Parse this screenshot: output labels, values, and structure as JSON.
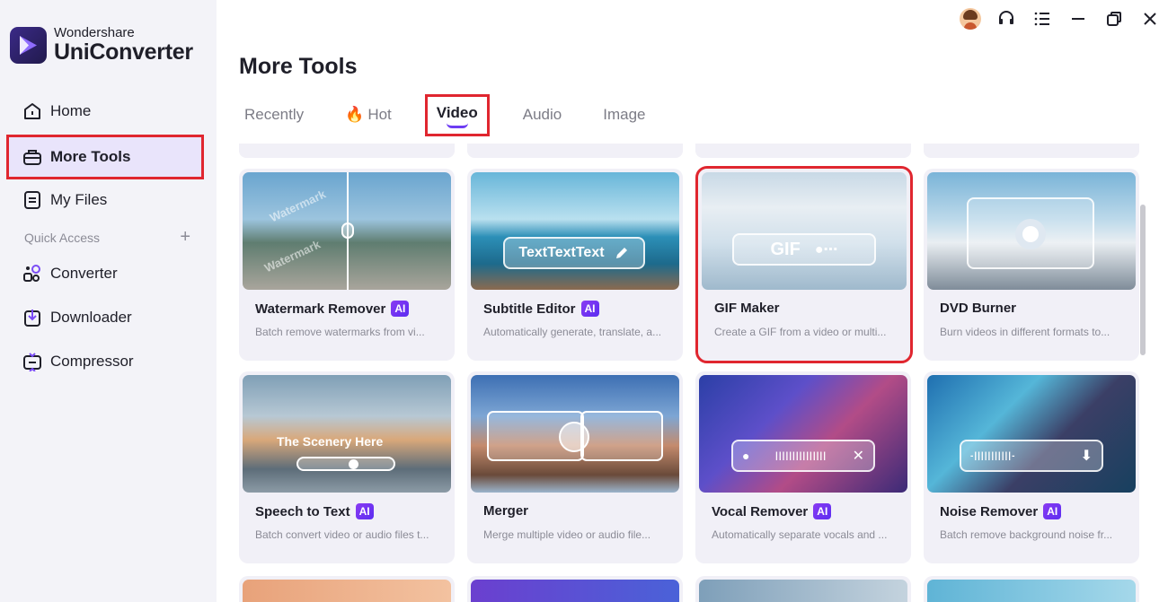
{
  "brand": {
    "line1": "Wondershare",
    "line2": "UniConverter"
  },
  "sidebar": {
    "items": [
      {
        "label": "Home",
        "icon": "home-icon"
      },
      {
        "label": "More Tools",
        "icon": "toolbox-icon",
        "active": true
      },
      {
        "label": "My Files",
        "icon": "files-icon"
      }
    ],
    "quick_access": {
      "label": "Quick Access",
      "add": "+"
    },
    "quick_items": [
      {
        "label": "Converter",
        "icon": "converter-icon"
      },
      {
        "label": "Downloader",
        "icon": "downloader-icon"
      },
      {
        "label": "Compressor",
        "icon": "compressor-icon"
      }
    ]
  },
  "topbar": [
    "avatar",
    "headset-icon",
    "menu-icon",
    "minimize-icon",
    "restore-icon",
    "close-icon"
  ],
  "page": {
    "title": "More Tools"
  },
  "tabs": [
    {
      "label": "Recently"
    },
    {
      "label": "Hot",
      "icon": "fire-icon"
    },
    {
      "label": "Video",
      "active": true
    },
    {
      "label": "Audio"
    },
    {
      "label": "Image"
    }
  ],
  "tools": [
    {
      "title": "Watermark Remover",
      "ai": "AI",
      "desc": "Batch remove watermarks from vi...",
      "overlay": "Watermark"
    },
    {
      "title": "Subtitle Editor",
      "ai": "AI",
      "desc": "Automatically generate, translate, a...",
      "overlay": "TextTextText"
    },
    {
      "title": "GIF Maker",
      "ai": "",
      "desc": "Create a GIF from a video or multi...",
      "overlay": "GIF"
    },
    {
      "title": "DVD Burner",
      "ai": "",
      "desc": "Burn videos in different formats to...",
      "overlay": ""
    },
    {
      "title": "Speech to Text",
      "ai": "AI",
      "desc": "Batch convert video or audio files t...",
      "overlay": "The Scenery Here"
    },
    {
      "title": "Merger",
      "ai": "",
      "desc": "Merge multiple video or audio file...",
      "overlay": ""
    },
    {
      "title": "Vocal Remover",
      "ai": "AI",
      "desc": "Automatically separate vocals and ...",
      "overlay": ""
    },
    {
      "title": "Noise Remover",
      "ai": "AI",
      "desc": "Batch remove background noise fr...",
      "overlay": ""
    }
  ],
  "colors": {
    "accent": "#6d3cf3",
    "highlight": "#e0262f",
    "active_bg": "#e9e4fb",
    "card_bg": "#f1f0f7"
  }
}
